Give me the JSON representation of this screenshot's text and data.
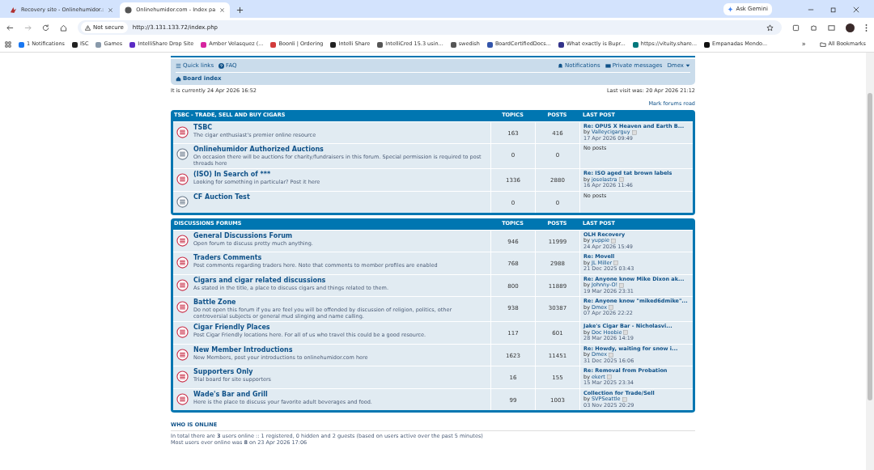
{
  "browser": {
    "tabs": [
      {
        "title": "Recovery site - Onlinehumidor.:",
        "selected": false
      },
      {
        "title": "Onlinehumidor.com - Index pa",
        "selected": true
      }
    ],
    "ask_button": "Ask Gemini",
    "security": "Not secure",
    "url": "http://3.131.133.72/index.php",
    "bookmarks": [
      {
        "label": "1 Notifications",
        "color": "#1877f2"
      },
      {
        "label": "ISC",
        "color": "#222222"
      },
      {
        "label": "Games",
        "color": "#8899aa"
      },
      {
        "label": "IntelliShare Drop Site",
        "color": "#5b2bc4"
      },
      {
        "label": "Amber Velasquez (...",
        "color": "#d6249f"
      },
      {
        "label": "Boonli | Ordering",
        "color": "#d23b3b"
      },
      {
        "label": "Intelli Share",
        "color": "#222222"
      },
      {
        "label": "IntelliCred 15.3 usin...",
        "color": "#555555"
      },
      {
        "label": "swedish",
        "color": "#555555"
      },
      {
        "label": "BoardCertifiedDocs...",
        "color": "#3355aa"
      },
      {
        "label": "What exactly is Bupr...",
        "color": "#33338a"
      },
      {
        "label": "https://vituity.share...",
        "color": "#03787c"
      },
      {
        "label": "Empanadas Mendo...",
        "color": "#111111"
      }
    ],
    "more_bookmarks": "»",
    "all_bookmarks": "All Bookmarks"
  },
  "navbar": {
    "quick_links": "Quick links",
    "faq": "FAQ",
    "notifications": "Notifications",
    "private_messages": "Private messages",
    "user": "Dmex",
    "breadcrumb": "Board index"
  },
  "current_time": "It is currently 24 Apr 2026 16:52",
  "last_visit": "Last visit was: 20 Apr 2026 21:12",
  "mark_read": "Mark forums read",
  "categories": [
    {
      "title": "TSBC - TRADE, SELL AND BUY CIGARS",
      "columns": [
        "TOPICS",
        "POSTS",
        "LAST POST"
      ],
      "forums": [
        {
          "name": "TSBC",
          "description": "The cigar enthusiast's premier online resource",
          "unread": true,
          "topics": "163",
          "posts": "416",
          "last_post": {
            "title": "Re: OPUS X Heaven and Earth B...",
            "by": "by",
            "author": "Valleycigarguy",
            "date": "17 Apr 2026 09:49"
          }
        },
        {
          "name": "Onlinehumidor Authorized Auctions",
          "description": "On occasion there will be auctions for charity/fundraisers in this forum. Special permission is required to post threads here",
          "unread": false,
          "topics": "0",
          "posts": "0",
          "no_posts": "No posts"
        },
        {
          "name": "(ISO) In Search of ***",
          "description": "Looking for something in particular? Post it here",
          "unread": true,
          "topics": "1336",
          "posts": "2880",
          "last_post": {
            "title": "Re: ISO aged tat brown labels",
            "by": "by",
            "author": "joselastra",
            "date": "16 Apr 2026 11:46"
          }
        },
        {
          "name": "CF Auction Test",
          "unread": false,
          "topics": "0",
          "posts": "0",
          "no_posts": "No posts"
        }
      ]
    },
    {
      "title": "DISCUSSIONS FORUMS",
      "columns": [
        "TOPICS",
        "POSTS",
        "LAST POST"
      ],
      "forums": [
        {
          "name": "General Discussions Forum",
          "description": "Open forum to discuss pretty much anything.",
          "unread": true,
          "topics": "946",
          "posts": "11999",
          "last_post": {
            "title": "OLH Recovery",
            "by": "by",
            "author": "yuppie",
            "date": "24 Apr 2026 15:49"
          }
        },
        {
          "name": "Traders Comments",
          "description": "Post comments regarding traders here. Note that comments to member profiles are enabled",
          "unread": true,
          "topics": "768",
          "posts": "2988",
          "last_post": {
            "title": "Re: Movell",
            "by": "by",
            "author": "JL Miller",
            "date": "21 Dec 2025 03:43"
          }
        },
        {
          "name": "Cigars and cigar related discussions",
          "description": "As stated in the title, a place to discuss cigars and things related to them.",
          "unread": true,
          "topics": "800",
          "posts": "11889",
          "last_post": {
            "title": "Re: Anyone know Mike Dixon ak...",
            "by": "by",
            "author": "Johnny-O!",
            "date": "19 Mar 2026 23:31"
          }
        },
        {
          "name": "Battle Zone",
          "description": "Do not open this forum if you are feel you will be offended by discussion of religion, politics, other controversial subjects or general mud slinging and name calling.",
          "unread": true,
          "topics": "938",
          "posts": "30387",
          "last_post": {
            "title": "Re: Anyone know \"miked6dmike\"...",
            "by": "by",
            "author": "Dmex",
            "date": "07 Apr 2026 22:22"
          }
        },
        {
          "name": "Cigar Friendly Places",
          "description": "Post Cigar Friendly locations here. For all of us who travel this could be a good resource.",
          "unread": true,
          "topics": "117",
          "posts": "601",
          "last_post": {
            "title": "Jake's Cigar Bar - Nicholasvi...",
            "by": "by",
            "author": "Doc Hoobie",
            "date": "28 Mar 2026 14:19"
          }
        },
        {
          "name": "New Member Introductions",
          "description": "New Members, post your introductions to onlinehumidor.com here",
          "unread": true,
          "topics": "1623",
          "posts": "11451",
          "last_post": {
            "title": "Re: Howdy, waiting for snow i...",
            "by": "by",
            "author": "Dmex",
            "date": "31 Dec 2025 16:06"
          }
        },
        {
          "name": "Supporters Only",
          "description": "Trial board for site supporters",
          "unread": true,
          "topics": "16",
          "posts": "155",
          "last_post": {
            "title": "Re: Removal from Probation",
            "by": "by",
            "author": "ekert",
            "date": "15 Mar 2025 23:34"
          }
        },
        {
          "name": "Wade's Bar and Grill",
          "description": "Here is the place to discuss your favorite adult beverages and food.",
          "unread": true,
          "topics": "99",
          "posts": "1003",
          "last_post": {
            "title": "Collection for Trade/Sell",
            "by": "by",
            "author": "SVPSeattle",
            "date": "03 Nov 2025 20:29"
          }
        }
      ]
    }
  ],
  "who_is_online": {
    "title": "WHO IS ONLINE",
    "lines": [
      "In total there are **3** users online :: 1 registered, 0 hidden and 2 guests (based on users active over the past 5 minutes)",
      "Most users ever online was **8** on 23 Apr 2026 17:06"
    ]
  }
}
